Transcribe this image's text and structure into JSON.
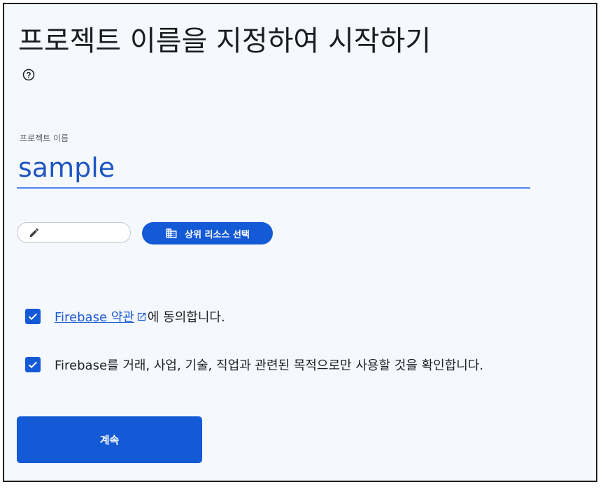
{
  "heading": {
    "title": "프로젝트 이름을 지정하여 시작하기",
    "help_icon": "help-circle-icon"
  },
  "project_name": {
    "label": "프로젝트 이름",
    "value": "sample"
  },
  "project_id_chip": {
    "icon": "pencil-icon",
    "text": ""
  },
  "parent_resource_button": {
    "icon": "building-icon",
    "label": "상위 리소스 선택"
  },
  "terms_checkbox": {
    "checked": true,
    "link_text": "Firebase 약관",
    "link_icon": "open-in-new-icon",
    "suffix": "에 동의합니다."
  },
  "purpose_checkbox": {
    "checked": true,
    "text": "Firebase를 거래, 사업, 기술, 직업과 관련된 목적으로만 사용할 것을 확인합니다."
  },
  "continue_button": {
    "label": "계속"
  },
  "colors": {
    "accent": "#1459d6",
    "input_underline": "#4f86ec",
    "background": "#f5f8fd"
  }
}
